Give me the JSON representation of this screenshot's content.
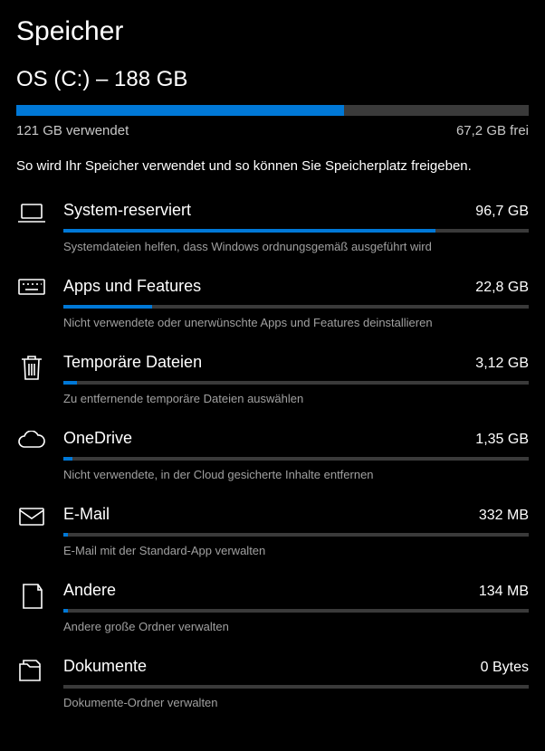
{
  "page_title": "Speicher",
  "drive_title": "OS (C:) – 188 GB",
  "main_bar_fill_pct": 64,
  "used_label": "121 GB verwendet",
  "free_label": "67,2 GB frei",
  "intro": "So wird Ihr Speicher verwendet und so können Sie Speicherplatz freigeben.",
  "categories": [
    {
      "name": "System-reserviert",
      "size": "96,7 GB",
      "pct": 80,
      "desc": "Systemdateien helfen, dass Windows ordnungsgemäß ausgeführt wird"
    },
    {
      "name": "Apps und Features",
      "size": "22,8 GB",
      "pct": 19,
      "desc": "Nicht verwendete oder unerwünschte Apps und Features deinstallieren"
    },
    {
      "name": "Temporäre Dateien",
      "size": "3,12 GB",
      "pct": 3,
      "desc": "Zu entfernende temporäre Dateien auswählen"
    },
    {
      "name": "OneDrive",
      "size": "1,35 GB",
      "pct": 2,
      "desc": "Nicht verwendete, in der Cloud gesicherte Inhalte entfernen"
    },
    {
      "name": "E-Mail",
      "size": "332 MB",
      "pct": 1,
      "desc": "E-Mail mit der Standard-App verwalten"
    },
    {
      "name": "Andere",
      "size": "134 MB",
      "pct": 1,
      "desc": "Andere große Ordner verwalten"
    },
    {
      "name": "Dokumente",
      "size": "0 Bytes",
      "pct": 0,
      "desc": "Dokumente-Ordner verwalten"
    }
  ],
  "chart_data": {
    "type": "bar",
    "title": "OS (C:) – 188 GB",
    "total_gb": 188,
    "used_gb": 121,
    "free_gb": 67.2,
    "series": [
      {
        "name": "System-reserviert",
        "value": 96.7,
        "unit": "GB"
      },
      {
        "name": "Apps und Features",
        "value": 22.8,
        "unit": "GB"
      },
      {
        "name": "Temporäre Dateien",
        "value": 3.12,
        "unit": "GB"
      },
      {
        "name": "OneDrive",
        "value": 1.35,
        "unit": "GB"
      },
      {
        "name": "E-Mail",
        "value": 332,
        "unit": "MB"
      },
      {
        "name": "Andere",
        "value": 134,
        "unit": "MB"
      },
      {
        "name": "Dokumente",
        "value": 0,
        "unit": "Bytes"
      }
    ]
  }
}
